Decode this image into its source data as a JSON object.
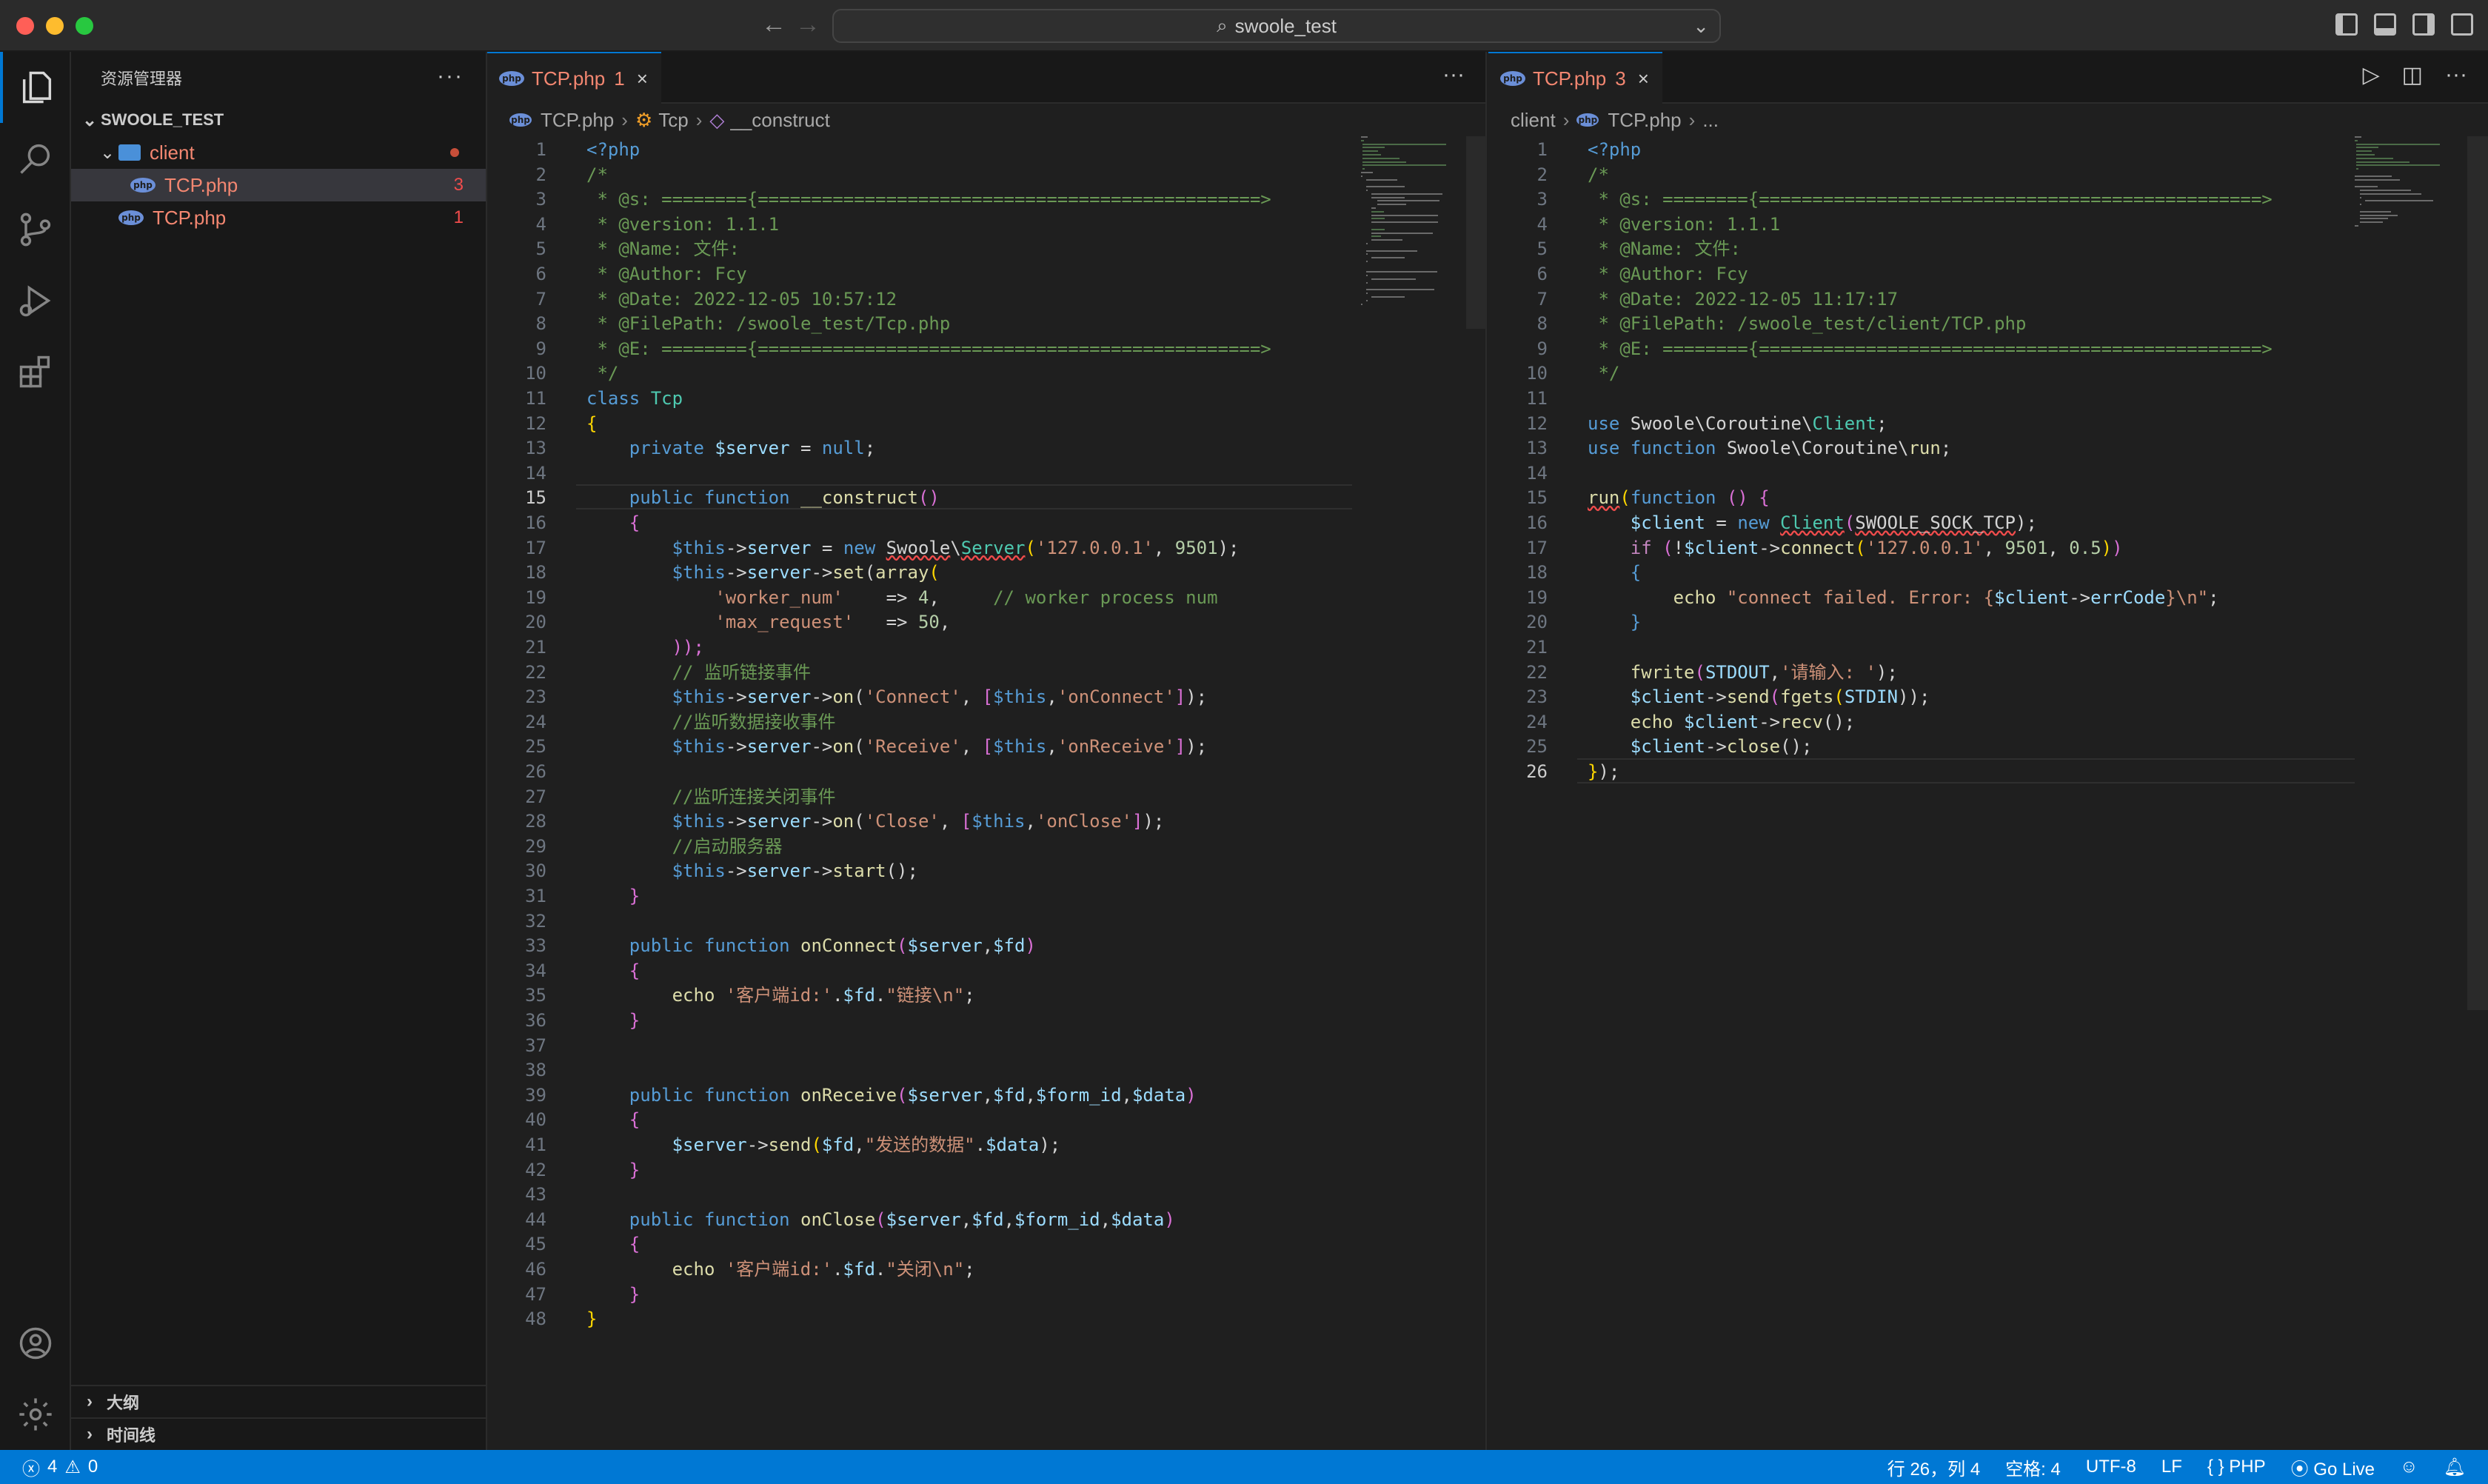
{
  "window": {
    "search_text": "swoole_test"
  },
  "sidebar": {
    "header": "资源管理器",
    "more": "···",
    "root": "SWOOLE_TEST",
    "folder": "client",
    "files": [
      {
        "name": "TCP.php",
        "badge": "3"
      },
      {
        "name": "TCP.php",
        "badge": "1"
      }
    ],
    "outline": "大纲",
    "timeline": "时间线"
  },
  "editor_left": {
    "tab": {
      "name": "TCP.php",
      "badge": "1"
    },
    "breadcrumb": [
      "TCP.php",
      "Tcp",
      "__construct"
    ],
    "current_line": 15,
    "lines": [
      [
        [
          "<?php",
          "t"
        ]
      ],
      [
        [
          "/*",
          "c"
        ]
      ],
      [
        [
          " * @s: ========{===============================================>",
          "c"
        ]
      ],
      [
        [
          " * @version: 1.1.1",
          "c"
        ]
      ],
      [
        [
          " * @Name: 文件:",
          "c"
        ]
      ],
      [
        [
          " * @Author: Fcy",
          "c"
        ]
      ],
      [
        [
          " * @Date: 2022-12-05 10:57:12",
          "c"
        ]
      ],
      [
        [
          " * @FilePath: /swoole_test/Tcp.php",
          "c"
        ]
      ],
      [
        [
          " * @E: ========{===============================================>",
          "c"
        ]
      ],
      [
        [
          " */",
          "c"
        ]
      ],
      [
        [
          "class ",
          "k"
        ],
        [
          "Tcp",
          "cls"
        ]
      ],
      [
        [
          "{",
          "b"
        ]
      ],
      [
        [
          "    ",
          ""
        ],
        [
          "private ",
          "k"
        ],
        [
          "$server",
          "v"
        ],
        [
          " = ",
          ""
        ],
        [
          "null",
          "k"
        ],
        [
          ";",
          ""
        ]
      ],
      [
        [
          "",
          ""
        ]
      ],
      [
        [
          "    ",
          ""
        ],
        [
          "public ",
          "k"
        ],
        [
          "function ",
          "k"
        ],
        [
          "__construct",
          "f"
        ],
        [
          "()",
          "p"
        ]
      ],
      [
        [
          "    ",
          ""
        ],
        [
          "{",
          "p"
        ]
      ],
      [
        [
          "        ",
          ""
        ],
        [
          "$this",
          "k"
        ],
        [
          "->",
          ""
        ],
        [
          "server",
          "v"
        ],
        [
          " = ",
          ""
        ],
        [
          "new ",
          "k"
        ],
        [
          "Swoole",
          "u"
        ],
        [
          "\\",
          ""
        ],
        [
          "Server",
          "ucls"
        ],
        [
          "(",
          "b"
        ],
        [
          "'127.0.0.1'",
          "s"
        ],
        [
          ", ",
          ""
        ],
        [
          "9501",
          "n"
        ],
        [
          ");",
          ""
        ]
      ],
      [
        [
          "        ",
          ""
        ],
        [
          "$this",
          "k"
        ],
        [
          "->",
          ""
        ],
        [
          "server",
          "v"
        ],
        [
          "->",
          ""
        ],
        [
          "set",
          "f"
        ],
        [
          "(",
          ""
        ],
        [
          "array",
          "f"
        ],
        [
          "(",
          "b"
        ]
      ],
      [
        [
          "            ",
          ""
        ],
        [
          "'worker_num'",
          "s"
        ],
        [
          "    => ",
          ""
        ],
        [
          "4",
          "n"
        ],
        [
          ",     ",
          ""
        ],
        [
          "// worker process num",
          "c"
        ]
      ],
      [
        [
          "            ",
          ""
        ],
        [
          "'max_request'",
          "s"
        ],
        [
          "   => ",
          ""
        ],
        [
          "50",
          "n"
        ],
        [
          ",",
          ""
        ]
      ],
      [
        [
          "        ",
          ""
        ],
        [
          "));",
          "p"
        ]
      ],
      [
        [
          "        ",
          ""
        ],
        [
          "// 监听链接事件",
          "c"
        ]
      ],
      [
        [
          "        ",
          ""
        ],
        [
          "$this",
          "k"
        ],
        [
          "->",
          ""
        ],
        [
          "server",
          "v"
        ],
        [
          "->",
          ""
        ],
        [
          "on",
          "f"
        ],
        [
          "(",
          ""
        ],
        [
          "'Connect'",
          "s"
        ],
        [
          ", ",
          ""
        ],
        [
          "[",
          "p"
        ],
        [
          "$this",
          "k"
        ],
        [
          ",",
          ""
        ],
        [
          "'onConnect'",
          "s"
        ],
        [
          "]",
          "p"
        ],
        [
          ");",
          ""
        ]
      ],
      [
        [
          "        ",
          ""
        ],
        [
          "//监听数据接收事件",
          "c"
        ]
      ],
      [
        [
          "        ",
          ""
        ],
        [
          "$this",
          "k"
        ],
        [
          "->",
          ""
        ],
        [
          "server",
          "v"
        ],
        [
          "->",
          ""
        ],
        [
          "on",
          "f"
        ],
        [
          "(",
          ""
        ],
        [
          "'Receive'",
          "s"
        ],
        [
          ", ",
          ""
        ],
        [
          "[",
          "p"
        ],
        [
          "$this",
          "k"
        ],
        [
          ",",
          ""
        ],
        [
          "'onReceive'",
          "s"
        ],
        [
          "]",
          "p"
        ],
        [
          ");",
          ""
        ]
      ],
      [
        [
          "",
          ""
        ]
      ],
      [
        [
          "        ",
          ""
        ],
        [
          "//监听连接关闭事件",
          "c"
        ]
      ],
      [
        [
          "        ",
          ""
        ],
        [
          "$this",
          "k"
        ],
        [
          "->",
          ""
        ],
        [
          "server",
          "v"
        ],
        [
          "->",
          ""
        ],
        [
          "on",
          "f"
        ],
        [
          "(",
          ""
        ],
        [
          "'Close'",
          "s"
        ],
        [
          ", ",
          ""
        ],
        [
          "[",
          "p"
        ],
        [
          "$this",
          "k"
        ],
        [
          ",",
          ""
        ],
        [
          "'onClose'",
          "s"
        ],
        [
          "]",
          "p"
        ],
        [
          ");",
          ""
        ]
      ],
      [
        [
          "        ",
          ""
        ],
        [
          "//启动服务器",
          "c"
        ]
      ],
      [
        [
          "        ",
          ""
        ],
        [
          "$this",
          "k"
        ],
        [
          "->",
          ""
        ],
        [
          "server",
          "v"
        ],
        [
          "->",
          ""
        ],
        [
          "start",
          "f"
        ],
        [
          "();",
          ""
        ]
      ],
      [
        [
          "    ",
          ""
        ],
        [
          "}",
          "p"
        ]
      ],
      [
        [
          "",
          ""
        ]
      ],
      [
        [
          "    ",
          ""
        ],
        [
          "public ",
          "k"
        ],
        [
          "function ",
          "k"
        ],
        [
          "onConnect",
          "f"
        ],
        [
          "(",
          "p"
        ],
        [
          "$server",
          "v"
        ],
        [
          ",",
          ""
        ],
        [
          "$fd",
          "v"
        ],
        [
          ")",
          "p"
        ]
      ],
      [
        [
          "    ",
          ""
        ],
        [
          "{",
          "p"
        ]
      ],
      [
        [
          "        ",
          ""
        ],
        [
          "echo ",
          "f"
        ],
        [
          "'客户端id:'",
          "s"
        ],
        [
          ".",
          ""
        ],
        [
          "$fd",
          "v"
        ],
        [
          ".",
          ""
        ],
        [
          "\"链接\\n\"",
          "s"
        ],
        [
          ";",
          ""
        ]
      ],
      [
        [
          "    ",
          ""
        ],
        [
          "}",
          "p"
        ]
      ],
      [
        [
          "",
          ""
        ]
      ],
      [
        [
          "",
          ""
        ]
      ],
      [
        [
          "    ",
          ""
        ],
        [
          "public ",
          "k"
        ],
        [
          "function ",
          "k"
        ],
        [
          "onReceive",
          "f"
        ],
        [
          "(",
          "p"
        ],
        [
          "$server",
          "v"
        ],
        [
          ",",
          ""
        ],
        [
          "$fd",
          "v"
        ],
        [
          ",",
          ""
        ],
        [
          "$form_id",
          "v"
        ],
        [
          ",",
          ""
        ],
        [
          "$data",
          "v"
        ],
        [
          ")",
          "p"
        ]
      ],
      [
        [
          "    ",
          ""
        ],
        [
          "{",
          "p"
        ]
      ],
      [
        [
          "        ",
          ""
        ],
        [
          "$server",
          "v"
        ],
        [
          "->",
          ""
        ],
        [
          "send",
          "f"
        ],
        [
          "(",
          "b"
        ],
        [
          "$fd",
          "v"
        ],
        [
          ",",
          ""
        ],
        [
          "\"发送的数据\"",
          "s"
        ],
        [
          ".",
          ""
        ],
        [
          "$data",
          "v"
        ],
        [
          ");",
          ""
        ]
      ],
      [
        [
          "    ",
          ""
        ],
        [
          "}",
          "p"
        ]
      ],
      [
        [
          "",
          ""
        ]
      ],
      [
        [
          "    ",
          ""
        ],
        [
          "public ",
          "k"
        ],
        [
          "function ",
          "k"
        ],
        [
          "onClose",
          "f"
        ],
        [
          "(",
          "p"
        ],
        [
          "$server",
          "v"
        ],
        [
          ",",
          ""
        ],
        [
          "$fd",
          "v"
        ],
        [
          ",",
          ""
        ],
        [
          "$form_id",
          "v"
        ],
        [
          ",",
          ""
        ],
        [
          "$data",
          "v"
        ],
        [
          ")",
          "p"
        ]
      ],
      [
        [
          "    ",
          ""
        ],
        [
          "{",
          "p"
        ]
      ],
      [
        [
          "        ",
          ""
        ],
        [
          "echo ",
          "f"
        ],
        [
          "'客户端id:'",
          "s"
        ],
        [
          ".",
          ""
        ],
        [
          "$fd",
          "v"
        ],
        [
          ".",
          ""
        ],
        [
          "\"关闭\\n\"",
          "s"
        ],
        [
          ";",
          ""
        ]
      ],
      [
        [
          "    ",
          ""
        ],
        [
          "}",
          "p"
        ]
      ],
      [
        [
          "}",
          "b"
        ]
      ]
    ]
  },
  "editor_right": {
    "tab": {
      "name": "TCP.php",
      "badge": "3"
    },
    "breadcrumb": [
      "client",
      "TCP.php",
      "..."
    ],
    "current_line": 26,
    "lines": [
      [
        [
          "<?php",
          "t"
        ]
      ],
      [
        [
          "/*",
          "c"
        ]
      ],
      [
        [
          " * @s: ========{===============================================>",
          "c"
        ]
      ],
      [
        [
          " * @version: 1.1.1",
          "c"
        ]
      ],
      [
        [
          " * @Name: 文件:",
          "c"
        ]
      ],
      [
        [
          " * @Author: Fcy",
          "c"
        ]
      ],
      [
        [
          " * @Date: 2022-12-05 11:17:17",
          "c"
        ]
      ],
      [
        [
          " * @FilePath: /swoole_test/client/TCP.php",
          "c"
        ]
      ],
      [
        [
          " * @E: ========{===============================================>",
          "c"
        ]
      ],
      [
        [
          " */",
          "c"
        ]
      ],
      [
        [
          "",
          ""
        ]
      ],
      [
        [
          "use ",
          "k"
        ],
        [
          "Swoole\\Coroutine\\",
          ""
        ],
        [
          "Client",
          "cls"
        ],
        [
          ";",
          ""
        ]
      ],
      [
        [
          "use ",
          "k"
        ],
        [
          "function ",
          "k"
        ],
        [
          "Swoole\\Coroutine\\",
          ""
        ],
        [
          "run",
          "f"
        ],
        [
          ";",
          ""
        ]
      ],
      [
        [
          "",
          ""
        ]
      ],
      [
        [
          "run",
          "fu"
        ],
        [
          "(",
          "b"
        ],
        [
          "function ",
          "k"
        ],
        [
          "() ",
          "p"
        ],
        [
          "{",
          "p"
        ]
      ],
      [
        [
          "    ",
          ""
        ],
        [
          "$client",
          "v"
        ],
        [
          " = ",
          ""
        ],
        [
          "new ",
          "k"
        ],
        [
          "Client",
          "ucls"
        ],
        [
          "(",
          "p"
        ],
        [
          "SWOOLE_SOCK_TCP",
          "uv"
        ],
        [
          ");",
          ""
        ]
      ],
      [
        [
          "    ",
          ""
        ],
        [
          "if ",
          "m"
        ],
        [
          "(",
          "p"
        ],
        [
          "!",
          ""
        ],
        [
          "$client",
          "v"
        ],
        [
          "->",
          ""
        ],
        [
          "connect",
          "f"
        ],
        [
          "(",
          "b"
        ],
        [
          "'127.0.0.1'",
          "s"
        ],
        [
          ", ",
          ""
        ],
        [
          "9501",
          "n"
        ],
        [
          ", ",
          ""
        ],
        [
          "0.5",
          "n"
        ],
        [
          ")",
          "b"
        ],
        [
          ")",
          "p"
        ]
      ],
      [
        [
          "    ",
          ""
        ],
        [
          "{",
          "k"
        ]
      ],
      [
        [
          "        ",
          ""
        ],
        [
          "echo ",
          "f"
        ],
        [
          "\"connect failed. Error: {",
          "s"
        ],
        [
          "$client",
          "v"
        ],
        [
          "->",
          ""
        ],
        [
          "errCode",
          "v"
        ],
        [
          "}\\n\"",
          "s"
        ],
        [
          ";",
          ""
        ]
      ],
      [
        [
          "    ",
          ""
        ],
        [
          "}",
          "k"
        ]
      ],
      [
        [
          "",
          ""
        ]
      ],
      [
        [
          "    ",
          ""
        ],
        [
          "fwrite",
          "f"
        ],
        [
          "(",
          "p"
        ],
        [
          "STDOUT",
          "v"
        ],
        [
          ",",
          ""
        ],
        [
          "'请输入: '",
          "s"
        ],
        [
          ");",
          ""
        ]
      ],
      [
        [
          "    ",
          ""
        ],
        [
          "$client",
          "v"
        ],
        [
          "->",
          ""
        ],
        [
          "send",
          "f"
        ],
        [
          "(",
          "p"
        ],
        [
          "fgets",
          "f"
        ],
        [
          "(",
          "b"
        ],
        [
          "STDIN",
          "v"
        ],
        [
          "));",
          ""
        ]
      ],
      [
        [
          "    ",
          ""
        ],
        [
          "echo ",
          "f"
        ],
        [
          "$client",
          "v"
        ],
        [
          "->",
          ""
        ],
        [
          "recv",
          "f"
        ],
        [
          "();",
          ""
        ]
      ],
      [
        [
          "    ",
          ""
        ],
        [
          "$client",
          "v"
        ],
        [
          "->",
          ""
        ],
        [
          "close",
          "f"
        ],
        [
          "();",
          ""
        ]
      ],
      [
        [
          "}",
          "b"
        ],
        [
          ");",
          ""
        ]
      ]
    ]
  },
  "statusbar": {
    "errors": "4",
    "warnings": "0",
    "position": "行 26，列 4",
    "spaces": "空格: 4",
    "encoding": "UTF-8",
    "eol": "LF",
    "language": "PHP",
    "golive": "Go Live"
  },
  "colors": {
    "accent": "#0078d4",
    "error": "#f48771"
  }
}
